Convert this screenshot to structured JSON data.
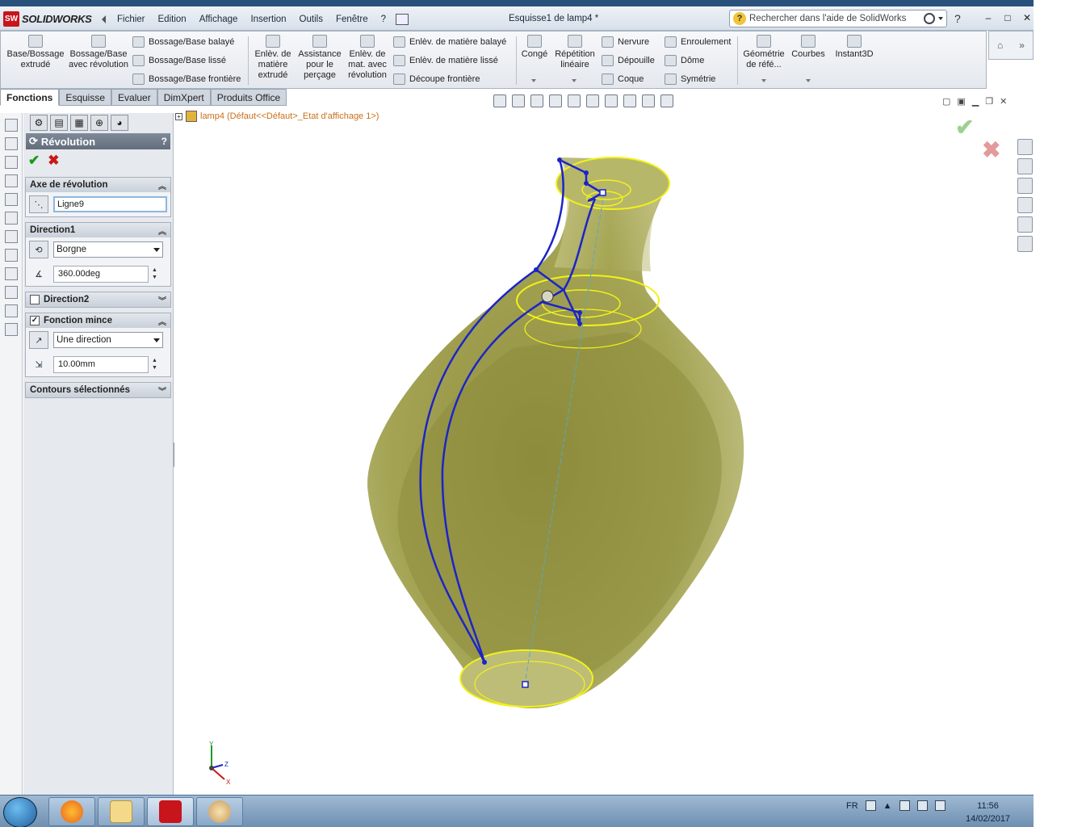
{
  "app": {
    "logo_mark": "SW",
    "logo_text": "SOLIDWORKS",
    "document_title": "Esquisse1 de lamp4 *",
    "menu": [
      "Fichier",
      "Edition",
      "Affichage",
      "Insertion",
      "Outils",
      "Fenêtre",
      "?"
    ],
    "search_placeholder": "Rechercher dans l'aide de SolidWorks",
    "help_label": "?",
    "window_controls": [
      "–",
      "□",
      "✕"
    ]
  },
  "command_manager": {
    "features": [
      {
        "label": "Base/Bossage extrudé",
        "icon": "extruded-boss-icon"
      },
      {
        "label": "Bossage/Base avec révolution",
        "icon": "revolved-boss-icon"
      },
      {
        "label": "Bossage/Base balayé",
        "icon": "swept-boss-icon"
      },
      {
        "label": "Bossage/Base lissé",
        "icon": "lofted-boss-icon"
      },
      {
        "label": "Bossage/Base frontière",
        "icon": "boundary-boss-icon"
      },
      {
        "label": "Enlèv. de matière extrudé",
        "icon": "extruded-cut-icon"
      },
      {
        "label": "Assistance pour le perçage",
        "icon": "hole-wizard-icon"
      },
      {
        "label": "Enlèv. de mat. avec révolution",
        "icon": "revolved-cut-icon"
      },
      {
        "label": "Enlèv. de matière balayé",
        "icon": "swept-cut-icon"
      },
      {
        "label": "Enlèv. de matière lissé",
        "icon": "lofted-cut-icon"
      },
      {
        "label": "Découpe frontière",
        "icon": "boundary-cut-icon"
      },
      {
        "label": "Congé",
        "icon": "fillet-icon"
      },
      {
        "label": "Répétition linéaire",
        "icon": "linear-pattern-icon"
      },
      {
        "label": "Nervure",
        "icon": "rib-icon"
      },
      {
        "label": "Dépouille",
        "icon": "draft-icon"
      },
      {
        "label": "Coque",
        "icon": "shell-icon"
      },
      {
        "label": "Enroulement",
        "icon": "wrap-icon"
      },
      {
        "label": "Dôme",
        "icon": "dome-icon"
      },
      {
        "label": "Symétrie",
        "icon": "mirror-icon"
      },
      {
        "label": "Géométrie de réfé...",
        "icon": "reference-geometry-icon"
      },
      {
        "label": "Courbes",
        "icon": "curves-icon"
      },
      {
        "label": "Instant3D",
        "icon": "instant3d-icon"
      }
    ]
  },
  "tabs": [
    "Fonctions",
    "Esquisse",
    "Evaluer",
    "DimXpert",
    "Produits Office"
  ],
  "active_tab": "Fonctions",
  "property_manager": {
    "title": "Révolution",
    "help": "?",
    "ok_symbol": "✔",
    "cancel_symbol": "✖",
    "axis_group": {
      "label": "Axe de révolution",
      "value": "Ligne9"
    },
    "direction1_group": {
      "label": "Direction1",
      "type": "Borgne",
      "angle": "360.00deg"
    },
    "direction2_group": {
      "label": "Direction2",
      "checked": false
    },
    "thin_group": {
      "label": "Fonction mince",
      "checked": true,
      "type": "Une direction",
      "thickness": "10.00mm"
    },
    "contours_group": {
      "label": "Contours sélectionnés"
    }
  },
  "feature_tree": {
    "expander": "+",
    "part_label": "lamp4  (Défaut<<Défaut>_Etat d'affichage 1>)"
  },
  "confirmation_corner": {
    "ok": "✔",
    "cancel": "✖"
  },
  "triad_labels": {
    "x": "X",
    "y": "Y",
    "z": "Z"
  },
  "colors": {
    "model_fill": "#a9a95a",
    "sketch_line": "#1c24c8",
    "edge_highlight": "#f2f21a",
    "axis_line": "#5aa7c9"
  },
  "taskbar": {
    "apps": [
      "firefox-icon",
      "file-explorer-icon",
      "solidworks-icon",
      "paint-icon"
    ],
    "language": "FR",
    "time": "11:56",
    "date": "14/02/2017"
  }
}
